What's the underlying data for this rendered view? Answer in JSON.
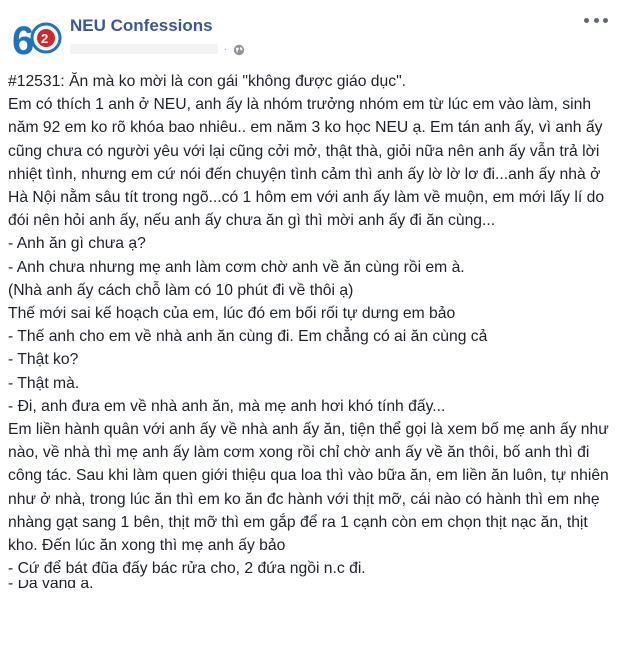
{
  "page": {
    "name": "NEU Confessions",
    "avatar_text": "62",
    "colors": {
      "page_name": "#385898",
      "body_text": "#1d2129",
      "avatar_blue": "#1e73be",
      "avatar_red": "#d0262d"
    }
  },
  "post": {
    "lines": [
      "#12531: Ăn mà ko mời là con gái \"không được giáo dục\".",
      "Em có thích 1 anh ở NEU, anh ấy là nhóm trưởng nhóm em từ lúc em vào làm, sinh năm 92 em ko rõ khóa bao nhiêu.. em năm 3 ko học NEU ạ. Em tán anh ấy, vì anh ấy cũng chưa có người yêu với lại cũng cởi mở, thật thà, giỏi nữa nên anh ấy vẫn trả lời nhiệt tình, nhưng em cứ nói đến chuyện tình cảm thì anh ấy lờ lờ lơ đi...anh ấy nhà ở Hà Nội nằm sâu tít trong ngõ...có 1 hôm em với anh ấy làm về muộn, em mới lấy lí do đói nên hỏi anh ấy, nếu anh ấy chưa ăn gì thì mời anh ấy đi ăn cùng...",
      "- Anh ăn gì chưa ạ?",
      "- Anh chưa nhưng mẹ anh làm cơm chờ anh về ăn cùng rồi em à.",
      "(Nhà anh ấy cách chỗ làm có 10 phút đi về thôi ạ)",
      "Thế mới sai kế hoạch của em, lúc đó em bối rối tự dưng em bảo",
      "- Thế anh cho em về nhà anh ăn cùng đi. Em chẳng có ai ăn cùng cả",
      "- Thật ko?",
      "- Thật mà.",
      "- Đi, anh đưa em về nhà anh ăn, mà mẹ anh hơi khó tính đấy...",
      "Em liền hành quân với anh ấy về nhà anh ấy ăn, tiện thể gọi là xem bố mẹ anh ấy như nào, về nhà thì mẹ anh ấy làm cơm xong rồi chỉ chờ anh ấy về ăn thôi, bố anh thì đi công tác. Sau khi làm quen giới thiệu qua loa thì vào bữa ăn, em liền ăn luôn, tự nhiên như ở nhà, trong lúc ăn thì em ko ăn đc hành với thịt mỡ, cái nào có hành thì em nhẹ nhàng gạt sang 1 bên, thịt mỡ thì em gắp để ra 1 cạnh còn em chọn thịt nạc ăn, thịt kho. Đến lúc ăn xong thì mẹ anh ấy bảo",
      "- Cứ để bát đũa đấy bác rửa cho, 2 đứa ngồi n.c đi.",
      "- Dạ vâng ạ."
    ]
  }
}
